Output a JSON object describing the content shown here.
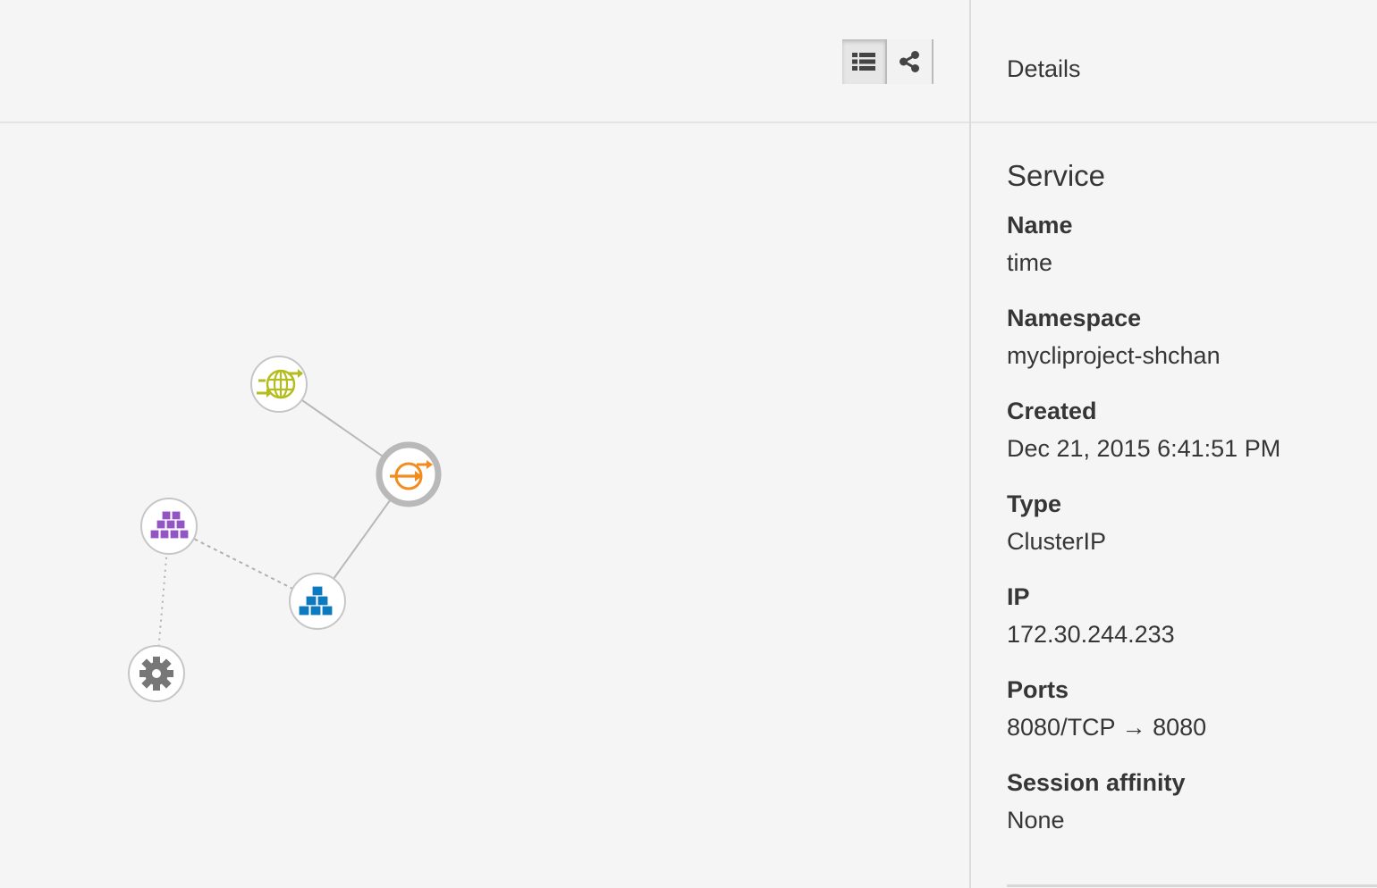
{
  "toolbar": {
    "list_view_icon": "list-icon",
    "topology_view_icon": "share-alt-icon",
    "active_view": "list"
  },
  "topology": {
    "nodes": [
      {
        "kind": "route",
        "icon": "globe-arrows-icon",
        "color": "#b5bd1e"
      },
      {
        "kind": "service",
        "icon": "service-arrow-icon",
        "color": "#f28c1e",
        "selected": true
      },
      {
        "kind": "deployment",
        "icon": "cubes-icon",
        "color": "#9354c4"
      },
      {
        "kind": "replication-controller",
        "icon": "cubes-icon",
        "color": "#0d79be"
      },
      {
        "kind": "deployment-config",
        "icon": "gear-icon",
        "color": "#777777"
      }
    ],
    "edges": [
      {
        "from": "route",
        "to": "service",
        "style": "solid"
      },
      {
        "from": "service",
        "to": "replication-controller",
        "style": "solid"
      },
      {
        "from": "deployment",
        "to": "replication-controller",
        "style": "dashed"
      },
      {
        "from": "deployment",
        "to": "deployment-config",
        "style": "dotted"
      }
    ]
  },
  "sidebar": {
    "title": "Details",
    "kind": "Service",
    "fields": [
      {
        "label": "Name",
        "value": "time"
      },
      {
        "label": "Namespace",
        "value": "mycliproject-shchan"
      },
      {
        "label": "Created",
        "value": "Dec 21, 2015 6:41:51 PM"
      },
      {
        "label": "Type",
        "value": "ClusterIP"
      },
      {
        "label": "IP",
        "value": "172.30.244.233"
      },
      {
        "label": "Ports",
        "value": "8080/TCP → 8080"
      },
      {
        "label": "Session affinity",
        "value": "None"
      }
    ]
  }
}
